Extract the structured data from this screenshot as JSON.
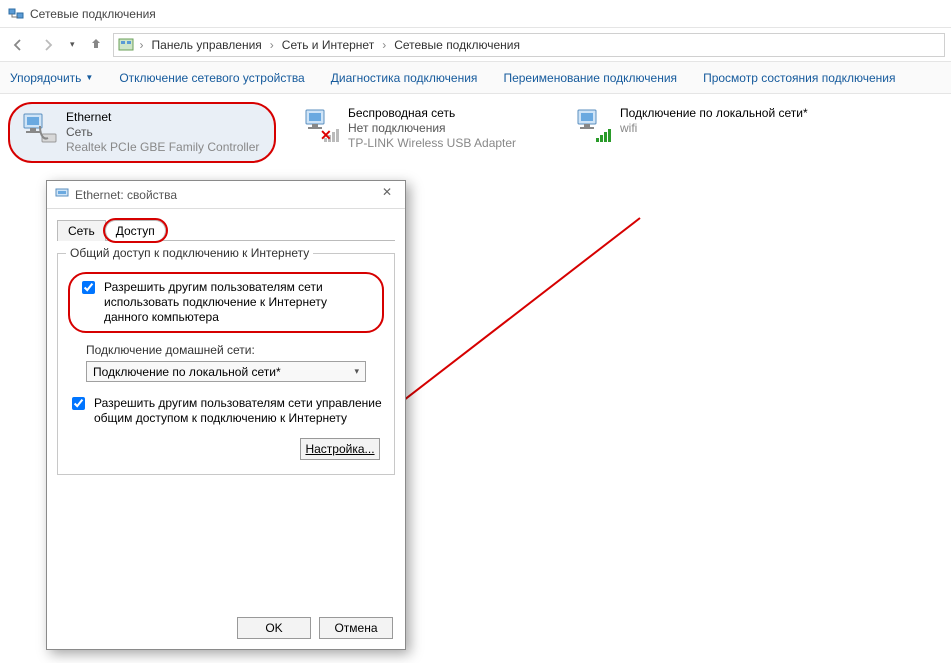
{
  "window": {
    "title": "Сетевые подключения"
  },
  "breadcrumb": {
    "items": [
      "Панель управления",
      "Сеть и Интернет",
      "Сетевые подключения"
    ]
  },
  "toolbar": {
    "organize": "Упорядочить",
    "disable": "Отключение сетевого устройства",
    "diagnose": "Диагностика подключения",
    "rename": "Переименование подключения",
    "status": "Просмотр состояния подключения"
  },
  "connections": [
    {
      "name": "Ethernet",
      "status": "Сеть",
      "adapter": "Realtek PCIe GBE Family Controller",
      "highlighted": true,
      "type": "wired"
    },
    {
      "name": "Беспроводная сеть",
      "status": "Нет подключения",
      "adapter": "TP-LINK Wireless USB Adapter",
      "highlighted": false,
      "type": "wifi-off"
    },
    {
      "name": "Подключение по локальной сети*",
      "status": "",
      "adapter": "wifi",
      "highlighted": false,
      "type": "wifi-on"
    }
  ],
  "dialog": {
    "title": "Ethernet: свойства",
    "tabs": {
      "network": "Сеть",
      "sharing": "Доступ"
    },
    "group_legend": "Общий доступ к подключению к Интернету",
    "checkbox1": "Разрешить другим пользователям сети использовать подключение к Интернету данного компьютера",
    "home_label": "Подключение домашней сети:",
    "home_select": "Подключение по локальной сети*",
    "checkbox2": "Разрешить другим пользователям сети управление общим доступом к подключению к Интернету",
    "configure": "Настройка...",
    "ok": "OK",
    "cancel": "Отмена"
  }
}
